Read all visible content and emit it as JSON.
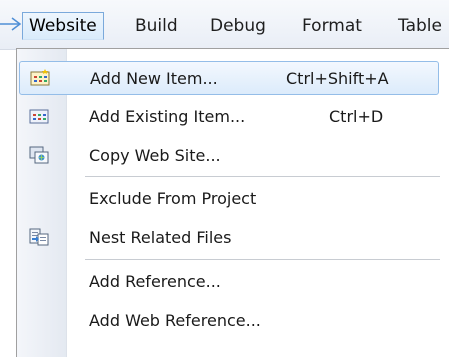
{
  "menubar": {
    "items": [
      {
        "label": "Website"
      },
      {
        "label": "Build"
      },
      {
        "label": "Debug"
      },
      {
        "label": "Format"
      },
      {
        "label": "Table"
      }
    ]
  },
  "dropdown": {
    "items": [
      {
        "label": "Add New Item...",
        "shortcut": "Ctrl+Shift+A",
        "icon": "add-new-item-icon"
      },
      {
        "label": "Add Existing Item...",
        "shortcut": "Ctrl+D",
        "icon": "add-existing-item-icon"
      },
      {
        "label": "Copy Web Site...",
        "shortcut": "",
        "icon": "copy-web-site-icon"
      },
      {
        "label": "Exclude From Project",
        "shortcut": "",
        "icon": ""
      },
      {
        "label": "Nest Related Files",
        "shortcut": "",
        "icon": "nest-related-files-icon"
      },
      {
        "label": "Add Reference...",
        "shortcut": "",
        "icon": ""
      },
      {
        "label": "Add Web Reference...",
        "shortcut": "",
        "icon": ""
      }
    ]
  },
  "colors": {
    "highlight_border": "#94bde8",
    "highlight_fill": "#dcebfb",
    "arrow": "#4f8fd6"
  }
}
